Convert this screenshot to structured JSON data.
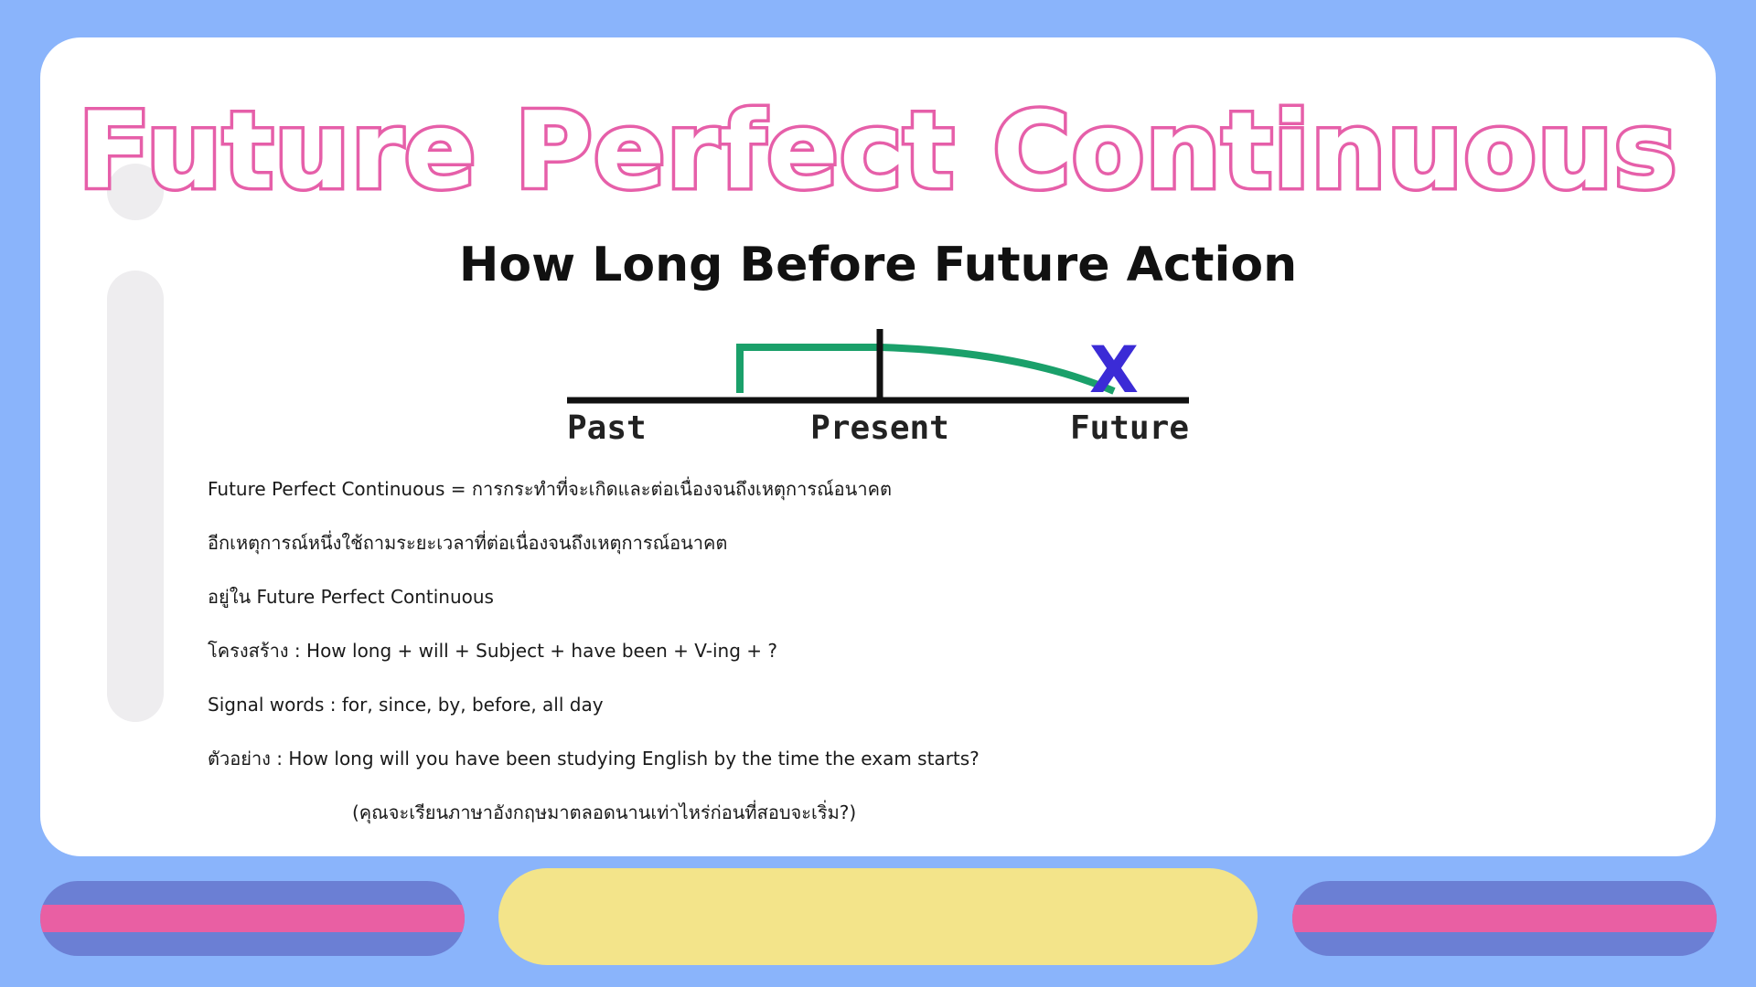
{
  "slide": {
    "title": "Future Perfect Continuous",
    "subtitle": "How Long Before Future Action"
  },
  "timeline": {
    "labels": {
      "past": "Past",
      "present": "Present",
      "future": "Future"
    },
    "marker": "X",
    "colors": {
      "axis": "#111111",
      "action": "#1aa06a",
      "marker": "#3b2bd6"
    }
  },
  "content": {
    "lines": [
      "Future Perfect Continuous = การกระทำที่จะเกิดและต่อเนื่องจนถึงเหตุการณ์อนาคต",
      "อีกเหตุการณ์หนึ่งใช้ถามระยะเวลาที่ต่อเนื่องจนถึงเหตุการณ์อนาคต",
      "อยู่ใน Future Perfect Continuous",
      "โครงสร้าง : How long + will + Subject + have been + V-ing + ?",
      "Signal words : for, since, by, before, all day",
      "ตัวอย่าง : How long will you have been studying English by the time the exam starts?"
    ],
    "translation": "(คุณจะเรียนภาษาอังกฤษมาตลอดนานเท่าไหร่ก่อนที่สอบจะเริ่ม?)"
  },
  "colors": {
    "background": "#8ab4fb",
    "card": "#ffffff",
    "title_outline": "#e65fa9",
    "bottom_pill": "#6b7fd4",
    "bottom_stripe": "#e95fa3",
    "center_pill": "#f3e48a"
  }
}
